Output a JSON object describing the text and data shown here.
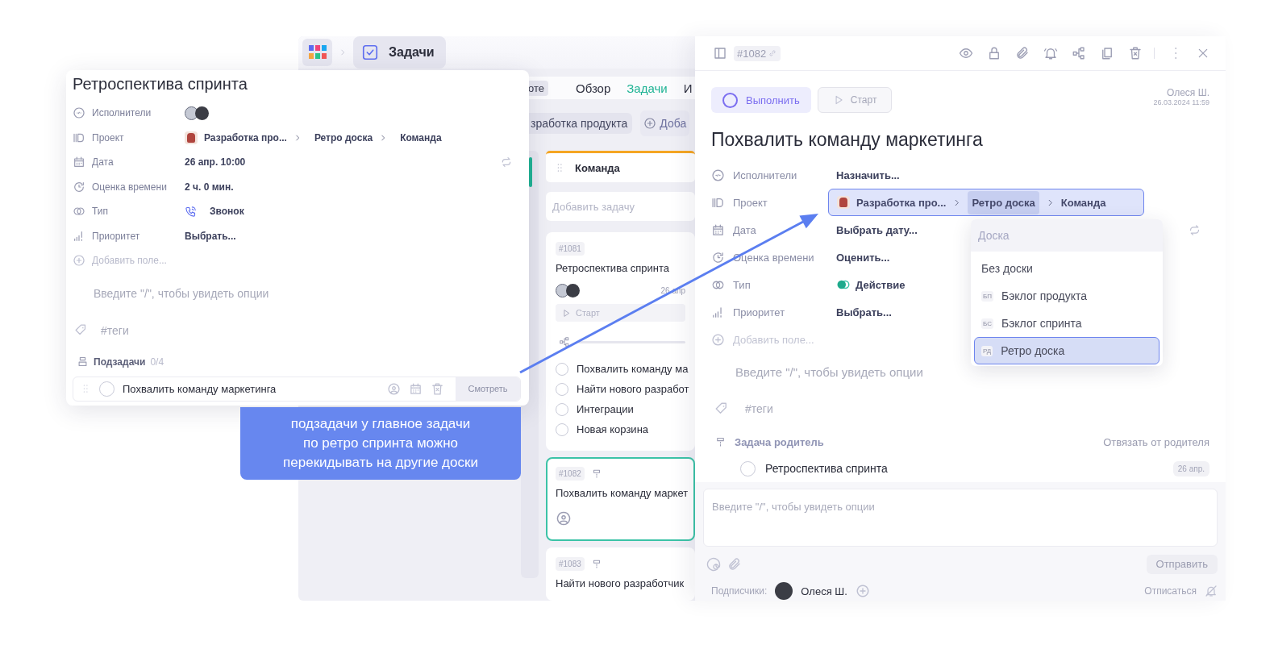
{
  "app_bar": {
    "section": "Задачи"
  },
  "nav": [
    {
      "label": "оте",
      "kind": "chip",
      "selected": false
    },
    {
      "label": "Обзор",
      "kind": "tab",
      "selected": false
    },
    {
      "label": "Задачи",
      "kind": "tab",
      "selected": true
    },
    {
      "label": "И",
      "kind": "tab",
      "selected": false
    }
  ],
  "board_filter": {
    "project": "зработка продукта",
    "add": "Доба"
  },
  "column": {
    "title": "Команда",
    "add_placeholder": "Добавить задачу",
    "cards": [
      {
        "id": "#1081",
        "title": "Ретроспектива спринта",
        "date": "26 апр",
        "start": "Старт",
        "selected": false,
        "subtasks": [
          "Похвалить команду ма",
          "Найти нового разработ",
          "Интеграции",
          "Новая корзина"
        ]
      },
      {
        "id": "#1082",
        "title": "Похвалить команду маркет",
        "selected": true,
        "parent": true
      },
      {
        "id": "#1083",
        "title": "Найти нового разработчик",
        "selected": false,
        "parent": true
      }
    ]
  },
  "task_card": {
    "title": "Ретроспектива спринта",
    "fields": [
      {
        "kind": "assignees",
        "label": "Исполнители",
        "avatars": true
      },
      {
        "kind": "project",
        "label": "Проект",
        "path": [
          {
            "label": "Разработка про...",
            "selected": false
          },
          {
            "label": "Ретро доска",
            "selected": false
          },
          {
            "label": "Команда",
            "selected": false
          }
        ]
      },
      {
        "kind": "date",
        "label": "Дата",
        "value": "26 апр. 10:00",
        "repeat": true
      },
      {
        "kind": "estimate",
        "label": "Оценка времени",
        "value": "2 ч. 0 мин."
      },
      {
        "kind": "type",
        "label": "Тип",
        "value": "Звонок",
        "type_icon": {
          "kind": "phone"
        }
      },
      {
        "kind": "priority",
        "label": "Приоритет",
        "value": "Выбрать..."
      }
    ],
    "add_field": "Добавить поле...",
    "editor_placeholder": "Введите \"/\", чтобы увидеть опции",
    "tags_placeholder": "#теги",
    "subtasks": {
      "label": "Подзадачи",
      "count": "0/4",
      "items": [
        {
          "title": "Похвалить команду маркетинга",
          "done": false,
          "action": "Смотреть"
        }
      ]
    }
  },
  "callout": {
    "lines": [
      "подзадачи у главное задачи",
      "по ретро спринта можно",
      "перекидывать на другие доски"
    ]
  },
  "detail": {
    "id": "#1082",
    "complete": "Выполнить",
    "done": false,
    "start": "Старт",
    "author": "Олеся Ш.",
    "created": "26.03.2024 11:59",
    "title": "Похвалить команду маркетинга",
    "fields": [
      {
        "kind": "assignees",
        "label": "Исполнители",
        "value": "Назначить..."
      },
      {
        "kind": "project",
        "label": "Проект",
        "active": true,
        "path": [
          {
            "label": "Разработка про...",
            "selected": false
          },
          {
            "label": "Ретро доска",
            "selected": true
          },
          {
            "label": "Команда",
            "selected": false
          }
        ]
      },
      {
        "kind": "date",
        "label": "Дата",
        "value": "Выбрать дату...",
        "repeat": true
      },
      {
        "kind": "estimate",
        "label": "Оценка времени",
        "value": "Оценить..."
      },
      {
        "kind": "type",
        "label": "Тип",
        "value": "Действие",
        "type_icon": {
          "kind": "toggle"
        }
      },
      {
        "kind": "priority",
        "label": "Приоритет",
        "value": "Выбрать..."
      }
    ],
    "add_field": "Добавить поле...",
    "editor_placeholder": "Введите \"/\", чтобы увидеть опции",
    "tags_placeholder": "#теги",
    "parent": {
      "label": "Задача родитель",
      "unlink": "Отвязать от родителя",
      "task": "Ретроспектива спринта",
      "done": false,
      "date": "26 апр."
    },
    "comment": {
      "placeholder": "Введите \"/\", чтобы увидеть опции",
      "send": "Отправить"
    },
    "subscribers": {
      "label": "Подписчики:",
      "names": [
        "Олеся Ш."
      ],
      "unsubscribe": "Отписаться"
    },
    "board_menu": {
      "placeholder": "Доска",
      "items": [
        {
          "label": "Без доски",
          "selected": false
        },
        {
          "badge": "БП",
          "label": "Бэклог продукта",
          "selected": false
        },
        {
          "badge": "БС",
          "label": "Бэклог спринта",
          "selected": false
        },
        {
          "badge": "РД",
          "label": "Ретро доска",
          "selected": true
        }
      ]
    }
  }
}
